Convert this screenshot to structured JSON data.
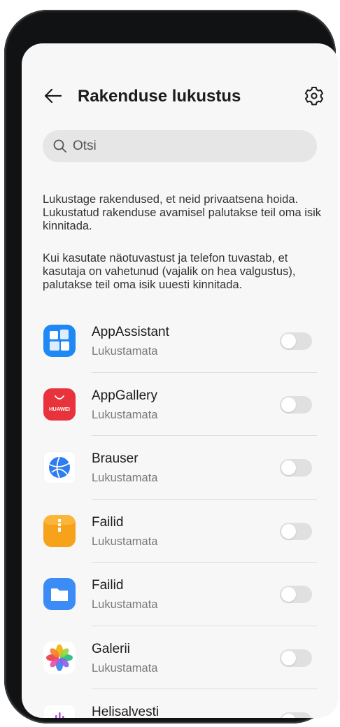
{
  "header": {
    "title": "Rakenduse lukustus",
    "back_icon": "arrow-left-icon",
    "settings_icon": "gear-icon"
  },
  "search": {
    "placeholder": "Otsi",
    "icon": "search-icon"
  },
  "description": {
    "paragraph1": "Lukustage rakendused, et neid privaatsena hoida. Lukustatud rakenduse avamisel palutakse teil oma isik kinnitada.",
    "paragraph2": "Kui kasutate näotuvastust ja telefon tuvastab, et kasutaja on vahetunud (vajalik on hea valgustus), palutakse teil oma isik uuesti kinnitada."
  },
  "apps": [
    {
      "name": "AppAssistant",
      "status": "Lukustamata",
      "locked": false,
      "icon": "app-assistant-icon"
    },
    {
      "name": "AppGallery",
      "status": "Lukustamata",
      "locked": false,
      "icon": "appgallery-icon",
      "icon_text": "HUAWEI"
    },
    {
      "name": "Brauser",
      "status": "Lukustamata",
      "locked": false,
      "icon": "browser-icon"
    },
    {
      "name": "Failid",
      "status": "Lukustamata",
      "locked": false,
      "icon": "files-zip-icon"
    },
    {
      "name": "Failid",
      "status": "Lukustamata",
      "locked": false,
      "icon": "folder-icon"
    },
    {
      "name": "Galerii",
      "status": "Lukustamata",
      "locked": false,
      "icon": "gallery-flower-icon"
    },
    {
      "name": "Helisalvesti",
      "status": "",
      "locked": false,
      "icon": "sound-recorder-icon"
    }
  ],
  "colors": {
    "toggle_off": "#e0e0e0",
    "appgallery_red": "#e8323c",
    "assistant_blue": "#1e88f5",
    "files_orange": "#f7a21b",
    "folder_blue": "#3b8cf6"
  }
}
